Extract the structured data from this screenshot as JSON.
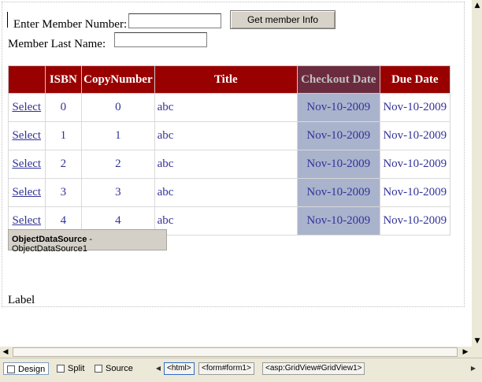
{
  "form": {
    "member_number_label": "Enter Member Number:",
    "member_number_value": "",
    "member_lastname_label": "Member Last Name:",
    "member_lastname_value": "",
    "get_member_button": "Get member Info"
  },
  "grid": {
    "columns": [
      "",
      "ISBN",
      "CopyNumber",
      "Title",
      "Checkout Date",
      "Due Date"
    ],
    "rows": [
      {
        "select": "Select",
        "isbn": "0",
        "copy": "0",
        "title": "abc",
        "checkout": "Nov-10-2009",
        "due": "Nov-10-2009"
      },
      {
        "select": "Select",
        "isbn": "1",
        "copy": "1",
        "title": "abc",
        "checkout": "Nov-10-2009",
        "due": "Nov-10-2009"
      },
      {
        "select": "Select",
        "isbn": "2",
        "copy": "2",
        "title": "abc",
        "checkout": "Nov-10-2009",
        "due": "Nov-10-2009"
      },
      {
        "select": "Select",
        "isbn": "3",
        "copy": "3",
        "title": "abc",
        "checkout": "Nov-10-2009",
        "due": "Nov-10-2009"
      },
      {
        "select": "Select",
        "isbn": "4",
        "copy": "4",
        "title": "abc",
        "checkout": "Nov-10-2009",
        "due": "Nov-10-2009"
      }
    ],
    "header_color": "#990000",
    "selected_column_color": "#a9b3cc"
  },
  "datasource": {
    "type": "ObjectDataSource",
    "separator": " - ",
    "id": "ObjectDataSource1"
  },
  "label_text": "Label",
  "view_tabs": {
    "design": "Design",
    "split": "Split",
    "source": "Source"
  },
  "breadcrumb": [
    "<html>",
    "<form#form1>",
    "<asp:GridView#GridView1>"
  ]
}
